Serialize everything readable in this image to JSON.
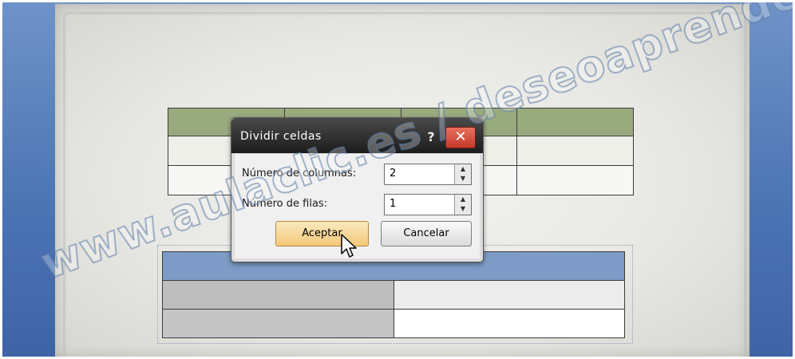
{
  "dialog": {
    "title": "Dividir celdas",
    "help_glyph": "?",
    "close_glyph": "✕",
    "columns_label": "Número de columnas:",
    "columns_value": "2",
    "rows_label": "Número de filas:",
    "rows_value": "1",
    "ok_label": "Aceptar",
    "cancel_label": "Cancelar"
  },
  "spinner": {
    "up": "▲",
    "down": "▼"
  },
  "watermark": {
    "text": "www.aulaclic.es / deseoaprender.com"
  },
  "colors": {
    "table_top_header": "#99ab7e",
    "table_bottom_header": "#7d9bc6",
    "accept_button": "#f2c878",
    "close_button": "#c53a2a"
  },
  "icons": [
    "help-icon",
    "close-icon",
    "spin-up-icon",
    "spin-down-icon",
    "mouse-cursor-icon"
  ]
}
